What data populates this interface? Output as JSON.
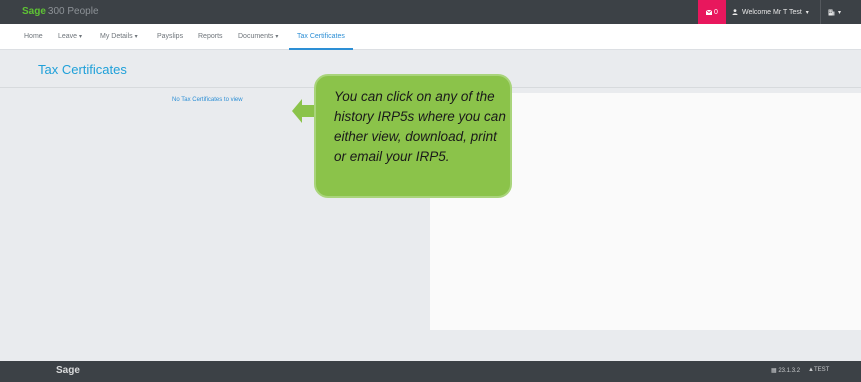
{
  "brand": {
    "logo": "Sage",
    "product": "300 People",
    "logo_color": "#5ec334"
  },
  "topbar": {
    "notification_count": "0",
    "notification_icon": "envelope-icon",
    "user_icon": "person-icon",
    "welcome_label": "Welcome Mr T Test",
    "menu_icon": "building-icon",
    "accent": "#e8175d"
  },
  "nav": {
    "items": [
      {
        "label": "Home"
      },
      {
        "label": "Leave"
      },
      {
        "label": "My Details"
      },
      {
        "label": "Payslips"
      },
      {
        "label": "Reports"
      },
      {
        "label": "Documents"
      },
      {
        "label": "Tax Certificates"
      }
    ],
    "active": "Tax Certificates"
  },
  "page": {
    "title": "Tax Certificates",
    "empty_message": "No Tax Certificates to view"
  },
  "callout": {
    "text": "You can click on any of the history IRP5s where you can either view, download, print or email your IRP5.",
    "color": "#8bc34a"
  },
  "footer": {
    "logo": "Sage",
    "version": "23.1.3.2",
    "environment": "TEST"
  }
}
